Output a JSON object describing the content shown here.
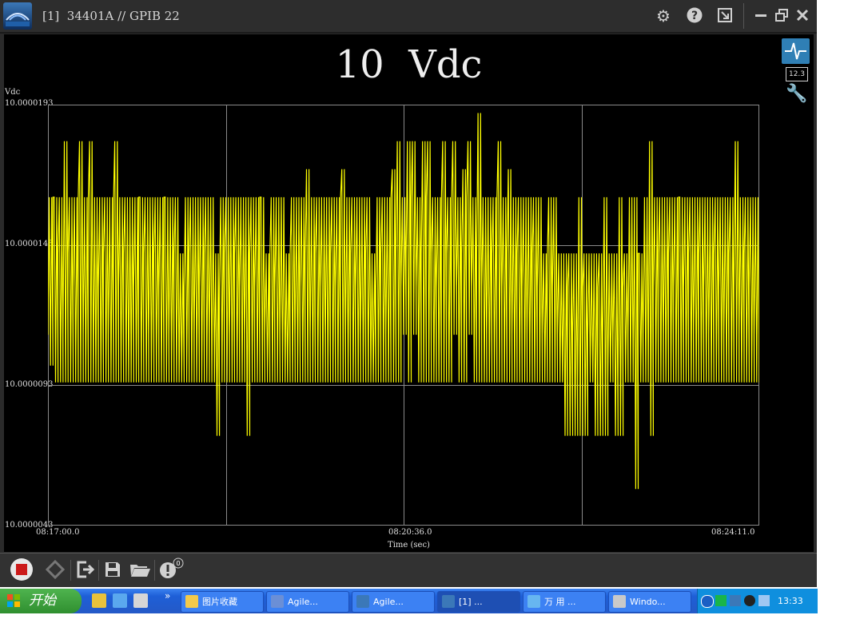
{
  "window": {
    "title": "[1]  34401A // GPIB 22",
    "icons": [
      "settings-gear-icon",
      "help-icon",
      "export-icon",
      "minimize-icon",
      "restore-icon",
      "close-icon"
    ]
  },
  "display": {
    "reading": "10  Vdc"
  },
  "side_buttons": {
    "chart_icon": "waveform-icon",
    "numeric_label": "12.3",
    "wrench_icon": "wrench-icon"
  },
  "chart_data": {
    "type": "line",
    "title": "",
    "ylabel": "Vdc",
    "xlabel": "Time (sec)",
    "ylim": [
      10.0000043,
      10.0000193
    ],
    "y_ticks": [
      "10.0000193",
      "10.0000143",
      "10.0000093",
      "10.0000043"
    ],
    "x_ticks": [
      "08:17:00.0",
      "08:20:36.0",
      "08:24:11.0"
    ],
    "grid": true,
    "series": [
      {
        "color": "#ffff00",
        "y": [
          10.0000111,
          10.000016,
          10.000014,
          10.0000111,
          10.000014,
          10.0000128,
          10.000016,
          10.0000111,
          10.000016,
          10.0000094,
          10.0000128,
          10.000014,
          10.0000111,
          10.000016,
          10.0000128,
          10.000014,
          10.0000094,
          10.0000128,
          10.000016,
          10.000014,
          10.0000111,
          10.000014,
          10.0000128,
          10.000016,
          10.0000111,
          10.000014,
          10.0000094,
          10.0000128,
          10.000014,
          10.0000111,
          10.0000128,
          10.000014,
          10.0000111,
          10.0000094,
          10.0000128,
          10.000014,
          10.0000111,
          10.000014,
          10.0000128,
          10.0000111,
          10.000014,
          10.0000128,
          10.000016,
          10.0000111,
          10.000014,
          10.0000128,
          10.0000111,
          10.0000094,
          10.000014,
          10.0000111,
          10.0000128,
          10.000014,
          10.0000111,
          10.000014,
          10.0000128,
          10.0000111,
          10.000014,
          10.0000128,
          10.000016,
          10.0000111,
          10.000014,
          10.0000128,
          10.0000111,
          10.000014,
          10.0000094,
          10.0000128,
          10.000014,
          10.0000111,
          10.000016,
          10.000014,
          10.0000128,
          10.000014,
          10.000016,
          10.0000128,
          10.000014,
          10.000016,
          10.000014,
          10.0000128,
          10.000016,
          10.000014,
          10.000016,
          10.0000128,
          10.000014,
          10.000016,
          10.0000128,
          10.000014,
          10.0000128,
          10.0000111,
          10.000014,
          10.000016,
          10.0000128,
          10.000014,
          10.0000111,
          10.000014,
          10.0000128,
          10.0000111,
          10.000014,
          10.0000128,
          10.0000111,
          10.000014,
          10.0000128,
          10.0000111,
          10.0000094,
          10.0000128,
          10.0000111,
          10.0000094,
          10.0000128,
          10.0000111,
          10.0000094,
          10.0000128,
          10.0000111,
          10.0000094,
          10.0000111,
          10.0000094,
          10.0000128,
          10.0000111,
          10.0000094,
          10.000014,
          10.0000111,
          10.0000094,
          10.0000128,
          10.000014,
          10.0000111,
          10.000014,
          10.0000128,
          10.000016,
          10.0000128,
          10.000014,
          10.0000111,
          10.000014,
          10.0000128,
          10.0000111,
          10.000014,
          10.0000128,
          10.0000111,
          10.000014,
          10.0000128,
          10.0000111,
          10.000014,
          10.0000128,
          10.0000111
        ],
        "y_min": [
          10.00001,
          10.0000094,
          10.0000094,
          10.0000094,
          10.0000094,
          10.0000094,
          10.0000094,
          10.0000094,
          10.0000094,
          10.0000094,
          10.0000094,
          10.0000094,
          10.0000094,
          10.0000094,
          10.0000094,
          10.0000094,
          10.0000094,
          10.0000094,
          10.0000094,
          10.0000094,
          10.0000094,
          10.0000094,
          10.0000094,
          10.0000094,
          10.0000094,
          10.0000094,
          10.0000094,
          10.0000094,
          10.0000094,
          10.0000094,
          10.0000094,
          10.0000094,
          10.0000094,
          10.0000075,
          10.0000094,
          10.0000094,
          10.0000094,
          10.0000094,
          10.0000094,
          10.0000075,
          10.0000094,
          10.0000094,
          10.0000094,
          10.0000094,
          10.0000094,
          10.0000094,
          10.0000094,
          10.0000094,
          10.0000094,
          10.0000094,
          10.0000094,
          10.0000094,
          10.0000094,
          10.0000094,
          10.0000094,
          10.0000094,
          10.0000094,
          10.0000094,
          10.0000094,
          10.0000094,
          10.0000094,
          10.0000094,
          10.0000094,
          10.0000094,
          10.0000094,
          10.0000094,
          10.0000094,
          10.0000094,
          10.0000094,
          10.0000094,
          10.0000111,
          10.0000094,
          10.0000111,
          10.0000094,
          10.0000094,
          10.0000094,
          10.0000094,
          10.0000094,
          10.0000094,
          10.0000094,
          10.0000111,
          10.0000094,
          10.0000094,
          10.0000111,
          10.0000094,
          10.0000094,
          10.0000094,
          10.0000094,
          10.0000094,
          10.0000094,
          10.0000094,
          10.0000094,
          10.0000094,
          10.0000094,
          10.0000094,
          10.0000094,
          10.0000094,
          10.0000094,
          10.0000094,
          10.0000094,
          10.0000094,
          10.0000094,
          10.0000075,
          10.0000075,
          10.0000075,
          10.0000075,
          10.0000075,
          10.0000094,
          10.0000075,
          10.0000075,
          10.0000075,
          10.0000094,
          10.0000075,
          10.0000075,
          10.0000094,
          10.0000094,
          10.0000056,
          10.0000094,
          10.0000094,
          10.0000075,
          10.0000094,
          10.0000094,
          10.0000094,
          10.0000094,
          10.0000094,
          10.0000094,
          10.0000094,
          10.0000094,
          10.0000094,
          10.0000094,
          10.0000094,
          10.0000094,
          10.0000094,
          10.0000094,
          10.0000094,
          10.0000094,
          10.0000094,
          10.0000094,
          10.0000094,
          10.0000094,
          10.0000094
        ],
        "y_max": [
          10.000016,
          10.000016,
          10.000016,
          10.000018,
          10.000016,
          10.000016,
          10.000018,
          10.000016,
          10.000018,
          10.000016,
          10.000016,
          10.000016,
          10.000016,
          10.000018,
          10.000016,
          10.000016,
          10.000016,
          10.000016,
          10.000016,
          10.000016,
          10.000016,
          10.000016,
          10.000016,
          10.000016,
          10.000016,
          10.000016,
          10.000014,
          10.000016,
          10.000016,
          10.000016,
          10.000016,
          10.000016,
          10.000016,
          10.000014,
          10.000016,
          10.000016,
          10.000016,
          10.000016,
          10.000016,
          10.000016,
          10.000016,
          10.000016,
          10.000016,
          10.000014,
          10.000016,
          10.000016,
          10.000016,
          10.000014,
          10.000016,
          10.000016,
          10.000016,
          10.000017,
          10.000016,
          10.000016,
          10.000016,
          10.000016,
          10.000016,
          10.000016,
          10.000017,
          10.000016,
          10.000016,
          10.000016,
          10.000016,
          10.000016,
          10.000014,
          10.000016,
          10.000016,
          10.000016,
          10.000017,
          10.000018,
          10.000016,
          10.000018,
          10.000018,
          10.000016,
          10.000018,
          10.000018,
          10.000016,
          10.000016,
          10.000018,
          10.000016,
          10.000018,
          10.000016,
          10.000017,
          10.000018,
          10.000016,
          10.000019,
          10.000016,
          10.000016,
          10.000016,
          10.000018,
          10.000016,
          10.000017,
          10.000016,
          10.000016,
          10.000016,
          10.000016,
          10.000016,
          10.000016,
          10.000014,
          10.000016,
          10.000016,
          10.000014,
          10.000014,
          10.000014,
          10.000014,
          10.000016,
          10.000014,
          10.000014,
          10.000014,
          10.000014,
          10.000016,
          10.000014,
          10.000014,
          10.000016,
          10.000014,
          10.000016,
          10.000016,
          10.000014,
          10.000016,
          10.000018,
          10.000016,
          10.000016,
          10.000016,
          10.000016,
          10.000016,
          10.000016,
          10.000016,
          10.000016,
          10.000016,
          10.000016,
          10.000016,
          10.000016,
          10.000016,
          10.000016,
          10.000016,
          10.000016,
          10.000018,
          10.000016,
          10.000016,
          10.000016,
          10.000016
        ]
      }
    ]
  },
  "toolbar": {
    "items": [
      "record-stop-icon",
      "refresh-icon",
      "exit-icon",
      "save-icon",
      "open-folder-icon",
      "alert-icon"
    ],
    "alert_count": "0"
  },
  "taskbar": {
    "start_label": "开始",
    "overflow": "»",
    "items": [
      {
        "label": "图片收藏",
        "icon": "folder-icon",
        "color": "#f3c94a"
      },
      {
        "label": "Agile...",
        "icon": "app-icon",
        "color": "#6b8fd6"
      },
      {
        "label": "Agile...",
        "icon": "meter-icon",
        "color": "#3b78b8"
      },
      {
        "label": "[1]  ...",
        "icon": "meter-icon",
        "color": "#3b78b8"
      },
      {
        "label": "万 用 ...",
        "icon": "ie-icon",
        "color": "#67b6f0"
      },
      {
        "label": "Windo...",
        "icon": "computer-icon",
        "color": "#c9c9c9"
      }
    ],
    "clock": "13:33"
  }
}
